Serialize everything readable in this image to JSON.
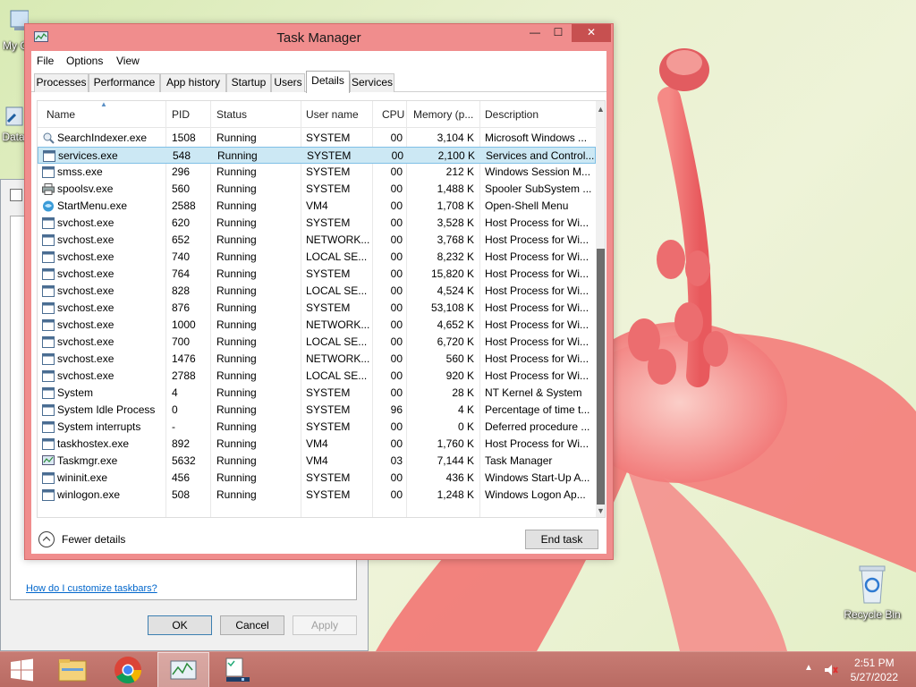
{
  "desktop": {
    "icons": [
      {
        "label": "My C"
      },
      {
        "label": "Data"
      },
      {
        "label": "Recycle Bin"
      }
    ]
  },
  "bg_dialog": {
    "link": "How do I customize taskbars?",
    "ok": "OK",
    "cancel": "Cancel",
    "apply": "Apply"
  },
  "task_manager": {
    "title": "Task Manager",
    "controls": {
      "minimize": "—",
      "maximize": "☐",
      "close": "✕"
    },
    "menu": [
      "File",
      "Options",
      "View"
    ],
    "tabs": [
      "Processes",
      "Performance",
      "App history",
      "Startup",
      "Users",
      "Details",
      "Services"
    ],
    "active_tab": "Details",
    "columns": [
      "Name",
      "PID",
      "Status",
      "User name",
      "CPU",
      "Memory (p...",
      "Description"
    ],
    "rows": [
      {
        "name": "SearchIndexer.exe",
        "pid": "1508",
        "status": "Running",
        "user": "SYSTEM",
        "cpu": "00",
        "mem": "3,104 K",
        "desc": "Microsoft Windows ...",
        "icon": "search-indexer-icon"
      },
      {
        "name": "services.exe",
        "pid": "548",
        "status": "Running",
        "user": "SYSTEM",
        "cpu": "00",
        "mem": "2,100 K",
        "desc": "Services and Control...",
        "icon": "window-app-icon",
        "selected": true
      },
      {
        "name": "smss.exe",
        "pid": "296",
        "status": "Running",
        "user": "SYSTEM",
        "cpu": "00",
        "mem": "212 K",
        "desc": "Windows Session M...",
        "icon": "window-app-icon"
      },
      {
        "name": "spoolsv.exe",
        "pid": "560",
        "status": "Running",
        "user": "SYSTEM",
        "cpu": "00",
        "mem": "1,488 K",
        "desc": "Spooler SubSystem ...",
        "icon": "printer-icon"
      },
      {
        "name": "StartMenu.exe",
        "pid": "2588",
        "status": "Running",
        "user": "VM4",
        "cpu": "00",
        "mem": "1,708 K",
        "desc": "Open-Shell Menu",
        "icon": "shell-icon"
      },
      {
        "name": "svchost.exe",
        "pid": "620",
        "status": "Running",
        "user": "SYSTEM",
        "cpu": "00",
        "mem": "3,528 K",
        "desc": "Host Process for Wi...",
        "icon": "window-app-icon"
      },
      {
        "name": "svchost.exe",
        "pid": "652",
        "status": "Running",
        "user": "NETWORK...",
        "cpu": "00",
        "mem": "3,768 K",
        "desc": "Host Process for Wi...",
        "icon": "window-app-icon"
      },
      {
        "name": "svchost.exe",
        "pid": "740",
        "status": "Running",
        "user": "LOCAL SE...",
        "cpu": "00",
        "mem": "8,232 K",
        "desc": "Host Process for Wi...",
        "icon": "window-app-icon"
      },
      {
        "name": "svchost.exe",
        "pid": "764",
        "status": "Running",
        "user": "SYSTEM",
        "cpu": "00",
        "mem": "15,820 K",
        "desc": "Host Process for Wi...",
        "icon": "window-app-icon"
      },
      {
        "name": "svchost.exe",
        "pid": "828",
        "status": "Running",
        "user": "LOCAL SE...",
        "cpu": "00",
        "mem": "4,524 K",
        "desc": "Host Process for Wi...",
        "icon": "window-app-icon"
      },
      {
        "name": "svchost.exe",
        "pid": "876",
        "status": "Running",
        "user": "SYSTEM",
        "cpu": "00",
        "mem": "53,108 K",
        "desc": "Host Process for Wi...",
        "icon": "window-app-icon"
      },
      {
        "name": "svchost.exe",
        "pid": "1000",
        "status": "Running",
        "user": "NETWORK...",
        "cpu": "00",
        "mem": "4,652 K",
        "desc": "Host Process for Wi...",
        "icon": "window-app-icon"
      },
      {
        "name": "svchost.exe",
        "pid": "700",
        "status": "Running",
        "user": "LOCAL SE...",
        "cpu": "00",
        "mem": "6,720 K",
        "desc": "Host Process for Wi...",
        "icon": "window-app-icon"
      },
      {
        "name": "svchost.exe",
        "pid": "1476",
        "status": "Running",
        "user": "NETWORK...",
        "cpu": "00",
        "mem": "560 K",
        "desc": "Host Process for Wi...",
        "icon": "window-app-icon"
      },
      {
        "name": "svchost.exe",
        "pid": "2788",
        "status": "Running",
        "user": "LOCAL SE...",
        "cpu": "00",
        "mem": "920 K",
        "desc": "Host Process for Wi...",
        "icon": "window-app-icon"
      },
      {
        "name": "System",
        "pid": "4",
        "status": "Running",
        "user": "SYSTEM",
        "cpu": "00",
        "mem": "28 K",
        "desc": "NT Kernel & System",
        "icon": "window-app-icon"
      },
      {
        "name": "System Idle Process",
        "pid": "0",
        "status": "Running",
        "user": "SYSTEM",
        "cpu": "96",
        "mem": "4 K",
        "desc": "Percentage of time t...",
        "icon": "window-app-icon"
      },
      {
        "name": "System interrupts",
        "pid": "-",
        "status": "Running",
        "user": "SYSTEM",
        "cpu": "00",
        "mem": "0 K",
        "desc": "Deferred procedure ...",
        "icon": "window-app-icon"
      },
      {
        "name": "taskhostex.exe",
        "pid": "892",
        "status": "Running",
        "user": "VM4",
        "cpu": "00",
        "mem": "1,760 K",
        "desc": "Host Process for Wi...",
        "icon": "window-app-icon"
      },
      {
        "name": "Taskmgr.exe",
        "pid": "5632",
        "status": "Running",
        "user": "VM4",
        "cpu": "03",
        "mem": "7,144 K",
        "desc": "Task Manager",
        "icon": "task-manager-icon"
      },
      {
        "name": "wininit.exe",
        "pid": "456",
        "status": "Running",
        "user": "SYSTEM",
        "cpu": "00",
        "mem": "436 K",
        "desc": "Windows Start-Up A...",
        "icon": "window-app-icon"
      },
      {
        "name": "winlogon.exe",
        "pid": "508",
        "status": "Running",
        "user": "SYSTEM",
        "cpu": "00",
        "mem": "1,248 K",
        "desc": "Windows Logon Ap...",
        "icon": "window-app-icon"
      }
    ],
    "fewer_details": "Fewer details",
    "end_task": "End task"
  },
  "taskbar": {
    "items": [
      "start-button",
      "file-explorer",
      "chrome",
      "task-manager",
      "taskbar-properties"
    ],
    "active_item": "task-manager",
    "time": "2:51 PM",
    "date": "5/27/2022"
  },
  "colors": {
    "window_frame": "#f08d8d",
    "selection": "#cce8f4",
    "taskbar": "#c77b73",
    "close_button": "#c75050"
  }
}
